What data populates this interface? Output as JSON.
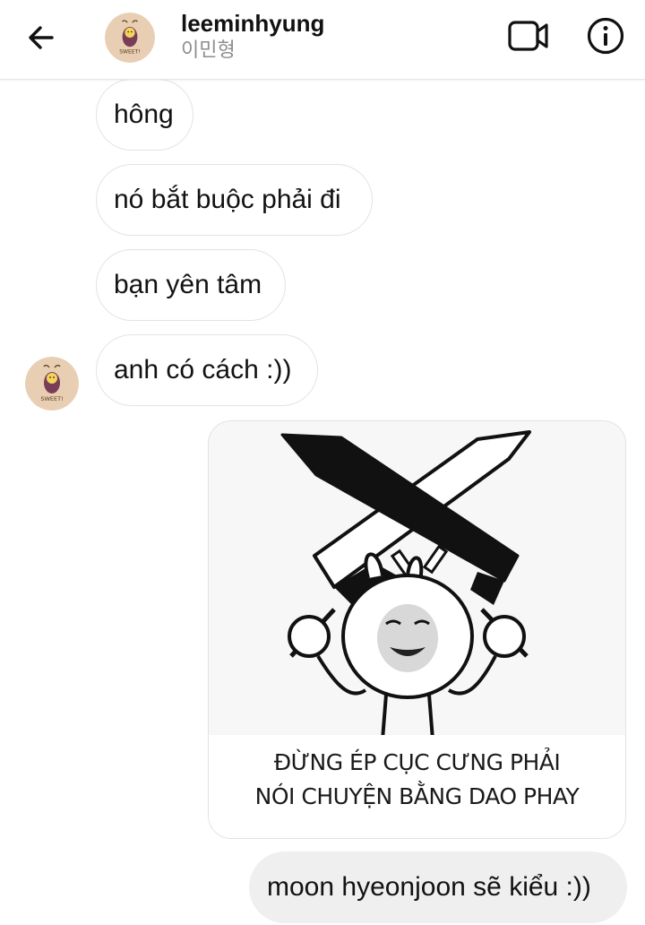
{
  "header": {
    "username": "leeminhyung",
    "subname": "이민형",
    "avatar_text": "SWEET!",
    "icons": [
      "back-arrow-icon",
      "video-call-icon",
      "info-icon"
    ]
  },
  "messages": [
    {
      "direction": "incoming",
      "text": "hông"
    },
    {
      "direction": "incoming",
      "text": "nó bắt buộc phải đi"
    },
    {
      "direction": "incoming",
      "text": "bạn yên tâm"
    },
    {
      "direction": "incoming",
      "text": "anh có cách :))"
    },
    {
      "direction": "outgoing",
      "type": "image",
      "caption_line1": "ĐỪNG ÉP CỤC CƯNG PHẢI",
      "caption_line2": "NÓI CHUYỆN BẰNG DAO PHAY"
    },
    {
      "direction": "outgoing",
      "text": "moon hyeonjoon sẽ kiểu :))"
    }
  ],
  "colors": {
    "incoming_bubble_border": "#e3e3e3",
    "outgoing_bubble_bg": "#efefef",
    "subtext": "#8e8e8e",
    "avatar_bg": "#e8cfb4"
  }
}
